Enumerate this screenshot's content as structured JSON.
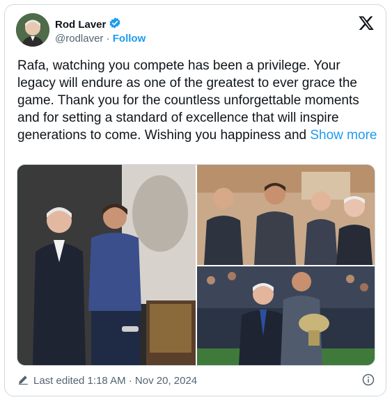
{
  "author": {
    "name": "Rod Laver",
    "handle": "@rodlaver",
    "separator": "·",
    "follow_label": "Follow",
    "verified_icon": "verified-badge-icon"
  },
  "brand_icon": "x-logo-icon",
  "tweet": {
    "text": "Rafa, watching you compete has been a privilege. Your legacy will endure as one of the greatest to ever grace the game. Thank you for the countless unforgettable moments and for setting a standard of excellence that will inspire generations to come. Wishing you happiness and",
    "show_more_label": "Show more"
  },
  "media": {
    "photo_count": 3
  },
  "footer": {
    "edited_label": "Last edited 1:18 AM · Nov 20, 2024",
    "edit_icon": "pencil-icon",
    "info_icon": "info-icon"
  },
  "colors": {
    "accent": "#1d9bf0",
    "secondary_text": "#536471",
    "border": "#cfd9de"
  }
}
